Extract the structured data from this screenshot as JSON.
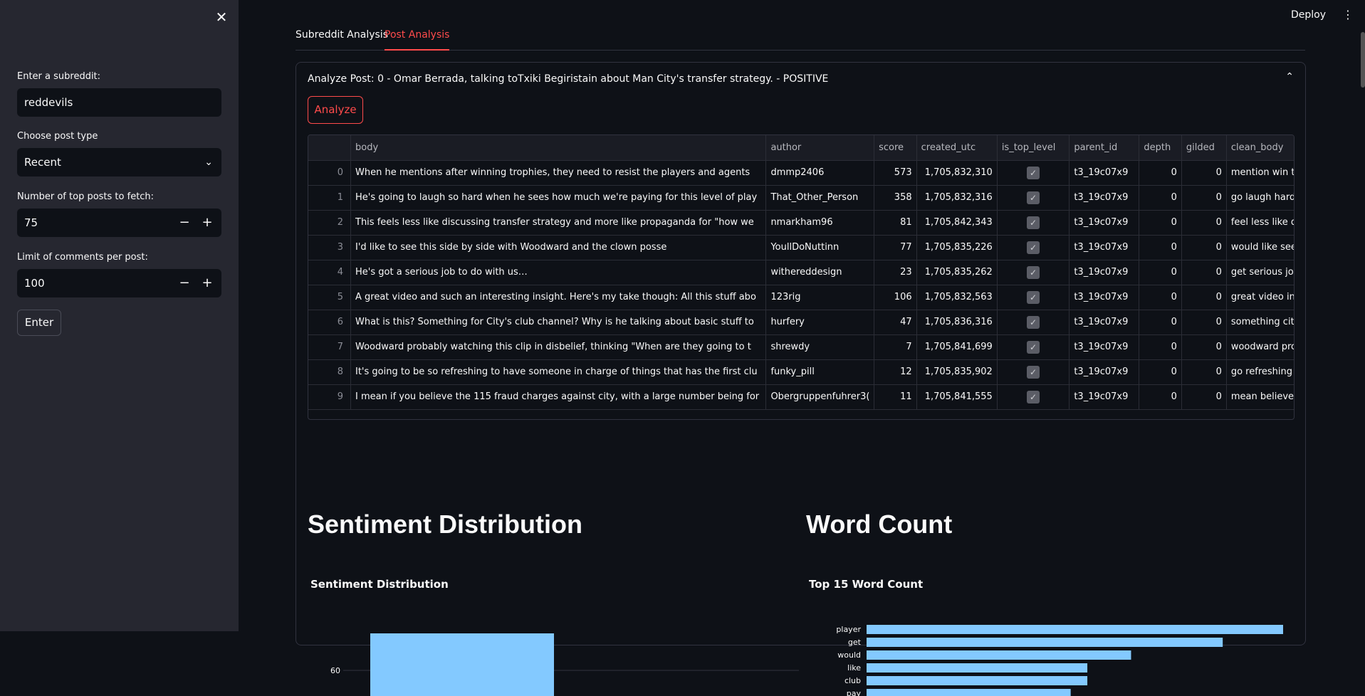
{
  "sidebar": {
    "subreddit_label": "Enter a subreddit:",
    "subreddit_value": "reddevils",
    "post_type_label": "Choose post type",
    "post_type_value": "Recent",
    "top_posts_label": "Number of top posts to fetch:",
    "top_posts_value": "75",
    "comment_limit_label": "Limit of comments per post:",
    "comment_limit_value": "100",
    "enter_label": "Enter"
  },
  "header": {
    "deploy_label": "Deploy"
  },
  "tabs": [
    {
      "label": "Subreddit Analysis",
      "active": false
    },
    {
      "label": "Post Analysis",
      "active": true
    }
  ],
  "expander": {
    "title": "Analyze Post: 0 - Omar Berrada, talking toTxiki Begiristain about Man City's transfer strategy. - POSITIVE",
    "analyze_label": "Analyze"
  },
  "table": {
    "columns": [
      "",
      "body",
      "author",
      "score",
      "created_utc",
      "is_top_level",
      "parent_id",
      "depth",
      "gilded",
      "clean_body"
    ],
    "rows": [
      [
        "0",
        "When he mentions after winning trophies, they need to resist the players and agents",
        "dmmp2406",
        "573",
        "1,705,832,310",
        "true",
        "t3_19c07x9",
        "0",
        "0",
        "mention win trophy need resist player agent ca"
      ],
      [
        "1",
        "He's going to laugh so hard when he sees how much we're paying for this level of play",
        "That_Other_Person",
        "358",
        "1,705,832,316",
        "true",
        "t3_19c07x9",
        "0",
        "0",
        "go laugh hard see much pay level play"
      ],
      [
        "2",
        "This feels less like discussing transfer strategy and more like propaganda for \"how we",
        "nmarkham96",
        "81",
        "1,705,842,343",
        "true",
        "t3_19c07x9",
        "0",
        "0",
        "feel less like discuss transfer strategy like propa"
      ],
      [
        "3",
        "I'd like to see this side by side with Woodward and the clown posse",
        "YoullDoNuttinn",
        "77",
        "1,705,835,226",
        "true",
        "t3_19c07x9",
        "0",
        "0",
        "would like see side side woodward clown posse"
      ],
      [
        "4",
        "He's got a serious job to do with us…",
        "withereddesign",
        "23",
        "1,705,835,262",
        "true",
        "t3_19c07x9",
        "0",
        "0",
        "get serious job we"
      ],
      [
        "5",
        "A great video and such an interesting insight. Here's my take though:  All this stuff abo",
        "123rig",
        "106",
        "1,705,832,563",
        "true",
        "t3_19c07x9",
        "0",
        "0",
        "great video interesting insight take though stuf"
      ],
      [
        "6",
        "What is this? Something for City's club channel? Why is he talking about basic stuff to",
        "hurfery",
        "47",
        "1,705,836,316",
        "true",
        "t3_19c07x9",
        "0",
        "0",
        "something city club channel talk basic stuff som"
      ],
      [
        "7",
        "Woodward probably watching this clip in disbelief, thinking \"When are they going to t",
        "shrewdy",
        "7",
        "1,705,841,699",
        "true",
        "t3_19c07x9",
        "0",
        "0",
        "woodward probably watch clip disbelief thinkin"
      ],
      [
        "8",
        "It's going to be so refreshing to have someone in charge of things that has the first clu",
        "funky_pill",
        "12",
        "1,705,835,902",
        "true",
        "t3_19c07x9",
        "0",
        "0",
        "go refreshing someone charge thing first clue fo"
      ],
      [
        "9",
        "I mean if you believe the 115 fraud charges against city, with a large number being for",
        "Obergruppenfuhrer3(",
        "11",
        "1,705,841,555",
        "true",
        "t3_19c07x9",
        "0",
        "0",
        "mean believe fraud charge city large number fa"
      ]
    ]
  },
  "sections": {
    "sentiment_heading": "Sentiment Distribution",
    "wordcount_heading": "Word Count"
  },
  "chart_data": [
    {
      "type": "bar",
      "title": "Sentiment Distribution",
      "y_tick_visible": [
        60
      ],
      "values_visible": [
        {
          "bar_index": 0,
          "value_exceeds": 60
        }
      ]
    },
    {
      "type": "bar",
      "orientation": "horizontal",
      "title": "Top 15 Word Count",
      "categories": [
        "player",
        "get",
        "would",
        "like",
        "club",
        "pay"
      ],
      "values": [
        20,
        17.1,
        12.7,
        10.6,
        10.6,
        9.8
      ]
    }
  ],
  "colors": {
    "accent": "#ff4b4b",
    "bar": "#83c9ff",
    "sidebar": "#262730",
    "background": "#0e1117"
  }
}
